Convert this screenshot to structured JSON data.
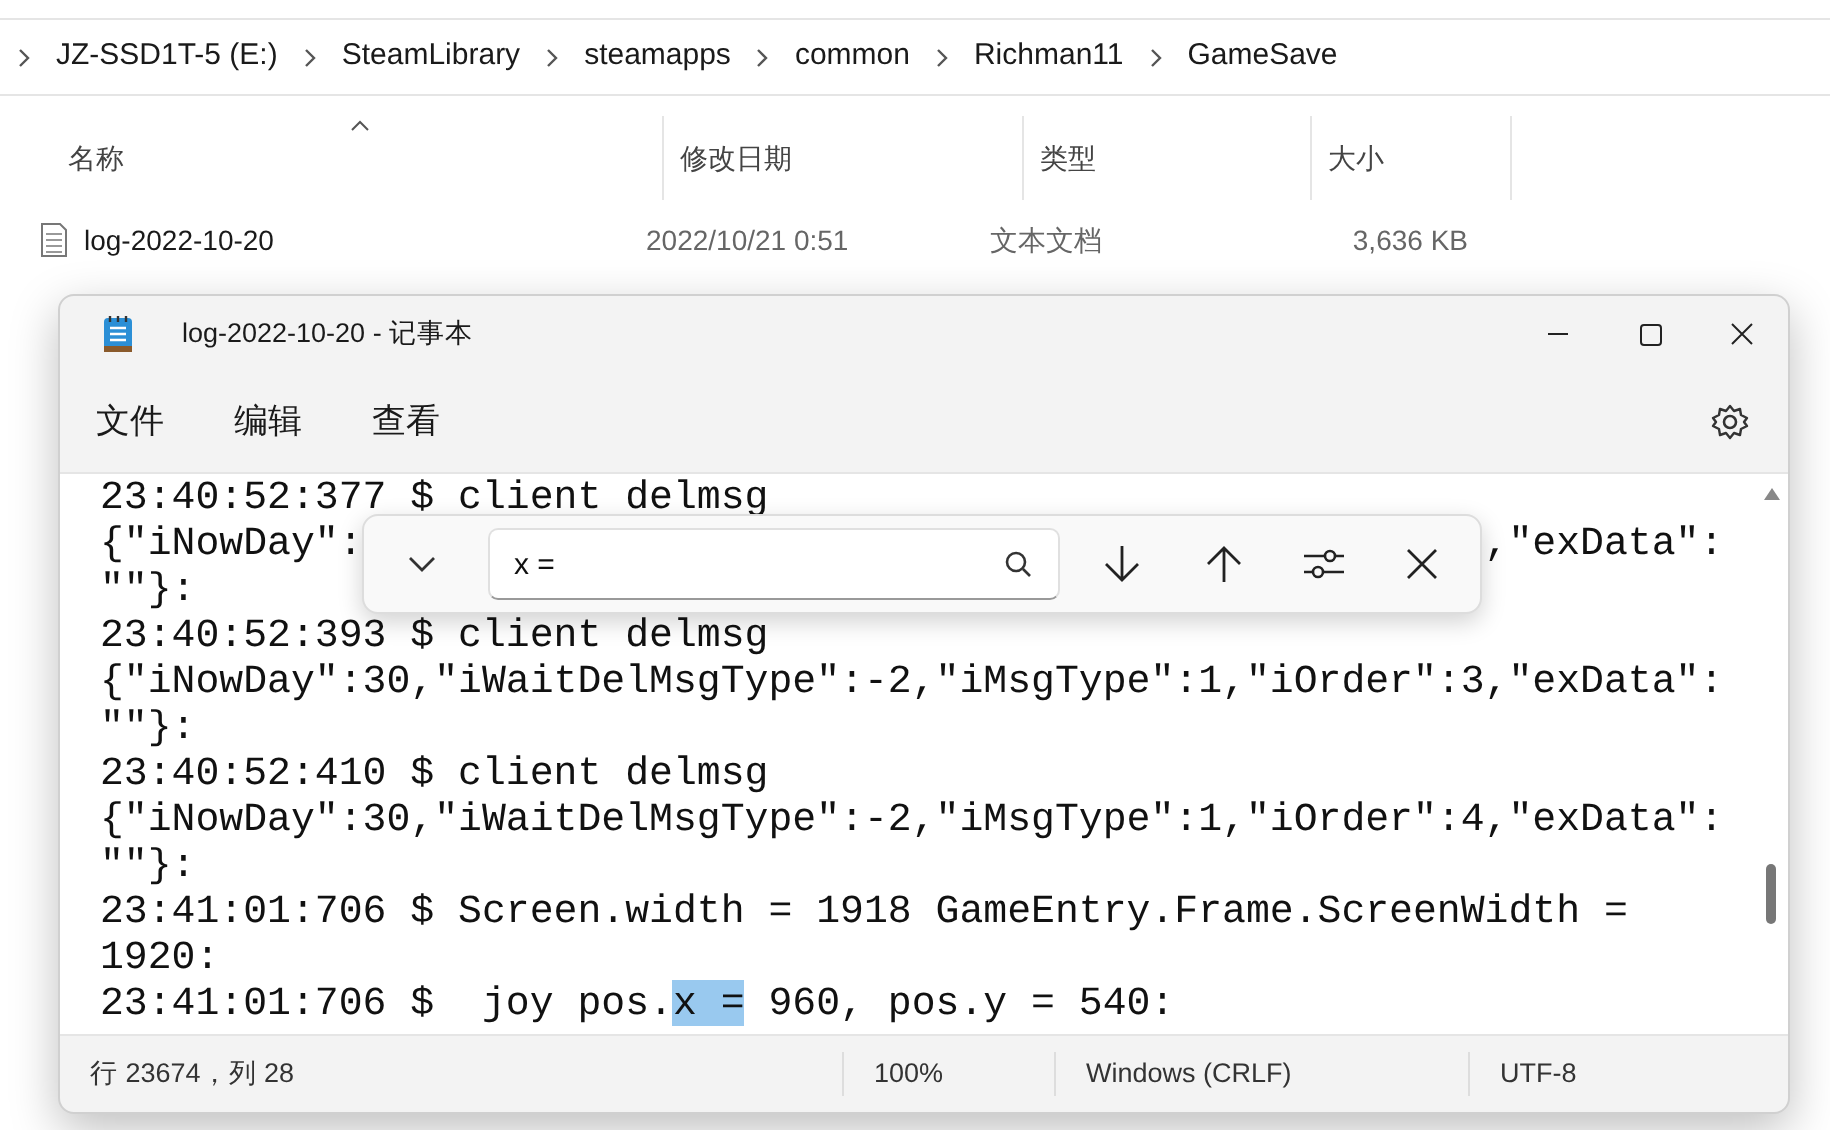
{
  "explorer": {
    "breadcrumb": [
      "JZ-SSD1T-5 (E:)",
      "SteamLibrary",
      "steamapps",
      "common",
      "Richman11",
      "GameSave"
    ],
    "columns": [
      {
        "label": "名称",
        "sorted": true
      },
      {
        "label": "修改日期",
        "sorted": false
      },
      {
        "label": "类型",
        "sorted": false
      },
      {
        "label": "大小",
        "sorted": false
      }
    ],
    "files": [
      {
        "name": "log-2022-10-20",
        "modified": "2022/10/21 0:51",
        "type": "文本文档",
        "size": "3,636 KB"
      }
    ]
  },
  "notepad": {
    "title": "log-2022-10-20 - 记事本",
    "menu": [
      "文件",
      "编辑",
      "查看"
    ],
    "lines": [
      {
        "kind": "plain",
        "segments": [
          {
            "text": "23:40:52:377 $ client delmsg",
            "highlighted": false
          }
        ]
      },
      {
        "kind": "split",
        "left": "{\"iNowDay\":",
        "right": ",\"exData\":"
      },
      {
        "kind": "plain",
        "segments": [
          {
            "text": "\"\"}:",
            "highlighted": false
          }
        ]
      },
      {
        "kind": "plain",
        "segments": [
          {
            "text": "23:40:52:393 $ client delmsg",
            "highlighted": false
          }
        ]
      },
      {
        "kind": "plain",
        "segments": [
          {
            "text": "{\"iNowDay\":30,\"iWaitDelMsgType\":-2,\"iMsgType\":1,\"iOrder\":3,\"exData\":",
            "highlighted": false
          }
        ]
      },
      {
        "kind": "plain",
        "segments": [
          {
            "text": "\"\"}:",
            "highlighted": false
          }
        ]
      },
      {
        "kind": "plain",
        "segments": [
          {
            "text": "23:40:52:410 $ client delmsg",
            "highlighted": false
          }
        ]
      },
      {
        "kind": "plain",
        "segments": [
          {
            "text": "{\"iNowDay\":30,\"iWaitDelMsgType\":-2,\"iMsgType\":1,\"iOrder\":4,\"exData\":",
            "highlighted": false
          }
        ]
      },
      {
        "kind": "plain",
        "segments": [
          {
            "text": "\"\"}:",
            "highlighted": false
          }
        ]
      },
      {
        "kind": "plain",
        "segments": [
          {
            "text": "23:41:01:706 $ Screen.width = 1918 GameEntry.Frame.ScreenWidth =",
            "highlighted": false
          }
        ]
      },
      {
        "kind": "plain",
        "segments": [
          {
            "text": "1920:",
            "highlighted": false
          }
        ]
      },
      {
        "kind": "plain",
        "segments": [
          {
            "text": "23:41:01:706 $  joy pos.",
            "highlighted": false
          },
          {
            "text": "x =",
            "highlighted": true
          },
          {
            "text": " 960, pos.y = 540:",
            "highlighted": false
          }
        ]
      }
    ],
    "find": {
      "value": "x ="
    },
    "status": [
      "行 23674，列 28",
      "100%",
      "Windows (CRLF)",
      "UTF-8"
    ]
  }
}
